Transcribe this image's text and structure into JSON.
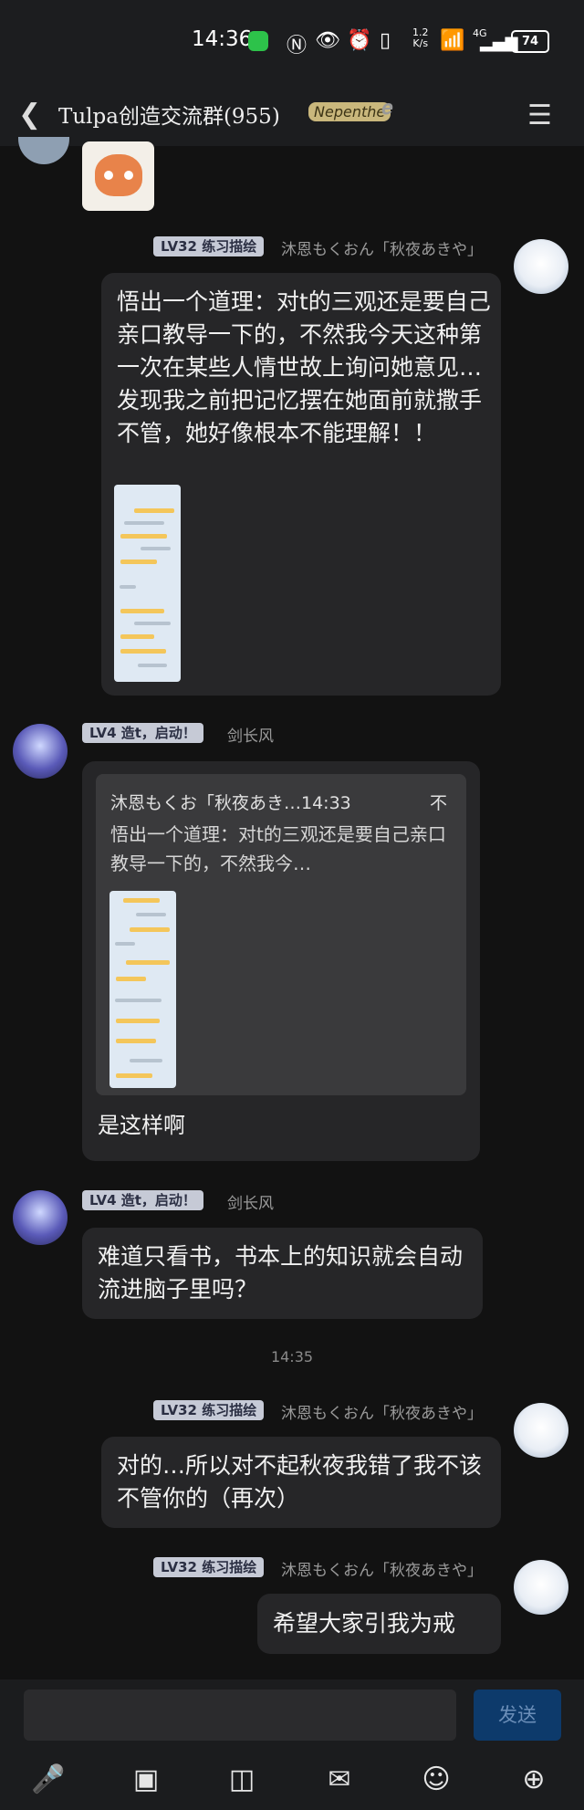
{
  "status_bar": {
    "time": "14:36",
    "speed_value": "1.2",
    "speed_unit": "K/s",
    "network": "4G",
    "battery": "74"
  },
  "header": {
    "title": "Tulpa创造交流群(955)",
    "badge": "Nepenthe"
  },
  "messages": [
    {
      "badge": "LV32 练习描绘",
      "sender": "沐恩もくおん「秋夜あきや」",
      "text": "悟出一个道理：对t的三观还是要自己亲口教导一下的，不然我今天这种第一次在某些人情世故上询问她意见…发现我之前把记忆摆在她面前就撒手不管，她好像根本不能理解！！"
    },
    {
      "badge": "LV4 造t，启动！",
      "sender": "剑长风",
      "quote_header": "沐恩もくお「秋夜あき…14:33",
      "quote_close": "不",
      "quote_text": "悟出一个道理：对t的三观还是要自己亲口教导一下的，不然我今…",
      "text": "是这样啊"
    },
    {
      "badge": "LV4 造t，启动！",
      "sender": "剑长风",
      "text": "难道只看书，书本上的知识就会自动流进脑子里吗？"
    },
    {
      "badge": "LV32 练习描绘",
      "sender": "沐恩もくおん「秋夜あきや」",
      "text": "对的…所以对不起秋夜我错了我不该不管你的（再次）"
    },
    {
      "badge": "LV32 练习描绘",
      "sender": "沐恩もくおん「秋夜あきや」",
      "text": "希望大家引我为戒"
    }
  ],
  "timestamp": "14:35",
  "input": {
    "send_label": "发送"
  },
  "toolbar": [
    "mic-icon",
    "image-icon",
    "camera-icon",
    "red-packet-icon",
    "emoji-icon",
    "plus-icon"
  ],
  "colors": {
    "background": "#121212",
    "bubble": "#262628",
    "badge": "#c6cad6",
    "send_button": "#0d3a6b"
  }
}
